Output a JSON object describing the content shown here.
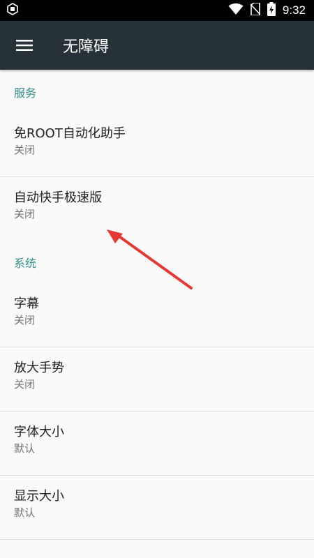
{
  "status_bar": {
    "time": "9:32",
    "left_icon": "notification-badge-icon",
    "icons": [
      "wifi-icon",
      "no-sim-icon",
      "battery-charging-icon"
    ]
  },
  "app_bar": {
    "title": "无障碍",
    "menu_icon": "hamburger-menu-icon"
  },
  "sections": [
    {
      "header": "服务",
      "items": [
        {
          "title": "免ROOT自动化助手",
          "summary": "关闭"
        },
        {
          "title": "自动快手极速版",
          "summary": "关闭"
        }
      ]
    },
    {
      "header": "系统",
      "items": [
        {
          "title": "字幕",
          "summary": "关闭"
        },
        {
          "title": "放大手势",
          "summary": "关闭"
        },
        {
          "title": "字体大小",
          "summary": "默认"
        },
        {
          "title": "显示大小",
          "summary": "默认"
        }
      ]
    }
  ],
  "colors": {
    "status_bar": "#000000",
    "app_bar": "#263238",
    "section_header": "#358C86",
    "background": "#FAFAFA",
    "annotation_arrow": "#E53935"
  }
}
